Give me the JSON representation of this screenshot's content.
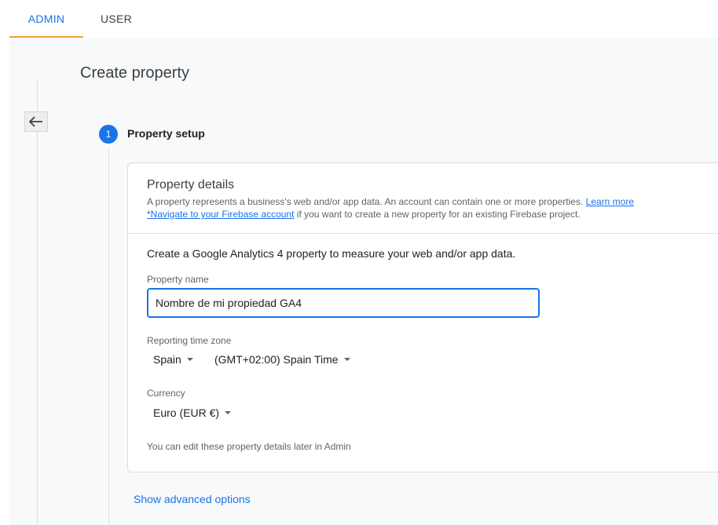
{
  "tabs": {
    "admin": "ADMIN",
    "user": "USER"
  },
  "page": {
    "title": "Create property"
  },
  "stepper": {
    "number": "1",
    "label": "Property setup"
  },
  "card": {
    "title": "Property details",
    "desc_text": "A property represents a business's web and/or app data. An account can contain one or more properties.",
    "learn_more": "Learn more",
    "firebase_link": "*Navigate to your Firebase account",
    "firebase_text": "if you want to create a new property for an existing Firebase project.",
    "intro": "Create a Google Analytics 4 property to measure your web and/or app data.",
    "property_name_label": "Property name",
    "property_name_value": "Nombre de mi propiedad GA4",
    "timezone_label": "Reporting time zone",
    "country": "Spain",
    "timezone": "(GMT+02:00) Spain Time",
    "currency_label": "Currency",
    "currency": "Euro (EUR €)",
    "note": "You can edit these property details later in Admin"
  },
  "advanced": "Show advanced options",
  "icons": {
    "back": "arrow-left-icon",
    "dropdown": "caret-down-icon"
  },
  "colors": {
    "accent": "#1a73e8",
    "tab_indicator": "#e8a33a",
    "background": "#f8f9fa"
  }
}
